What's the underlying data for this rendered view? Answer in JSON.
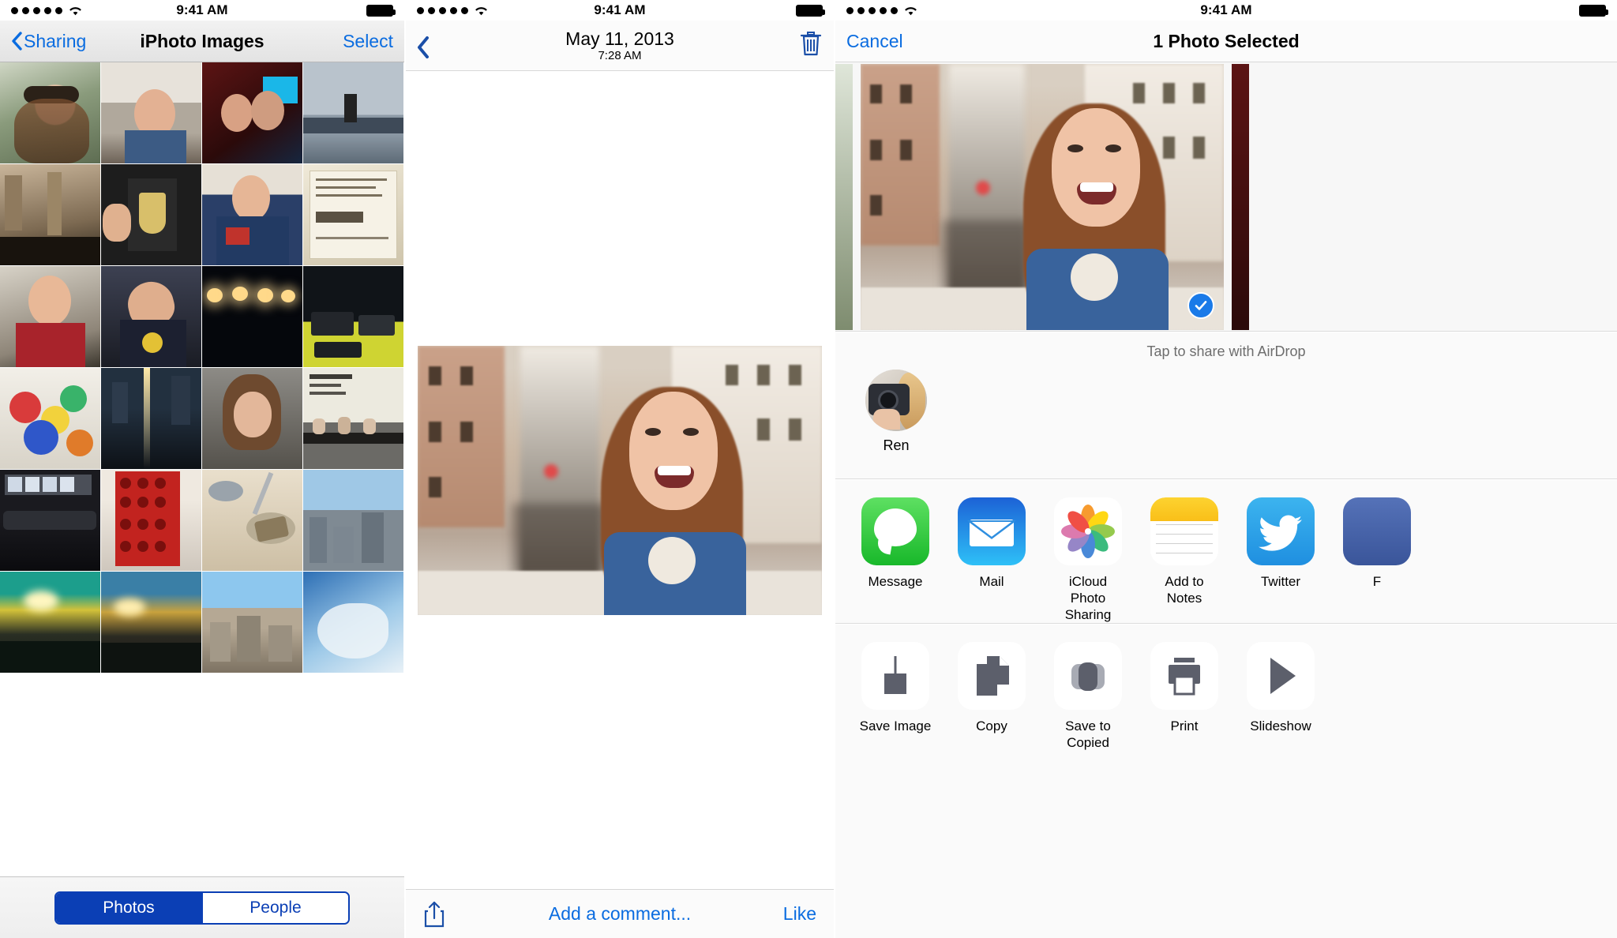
{
  "statusbar": {
    "time": "9:41 AM",
    "signal_dots": 5,
    "wifi_icon": "wifi-icon",
    "battery_icon": "battery-full-icon"
  },
  "panel1": {
    "nav": {
      "back_label": "Sharing",
      "back_icon": "chevron-left-icon",
      "title": "iPhoto Images",
      "right_label": "Select"
    },
    "grid": {
      "columns": 4,
      "rows": 6,
      "cells": [
        {
          "name": "woman-sunglasses-portrait"
        },
        {
          "name": "woman-smiling-piazza"
        },
        {
          "name": "two-women-bar-night"
        },
        {
          "name": "roller-derby-rink"
        },
        {
          "name": "mall-interior-crowd"
        },
        {
          "name": "thumbs-up-anchor-shirt"
        },
        {
          "name": "woman-flag-tank-top"
        },
        {
          "name": "movie-ticket-stub"
        },
        {
          "name": "woman-red-top-smiling"
        },
        {
          "name": "woman-looking-up"
        },
        {
          "name": "stage-lights-night"
        },
        {
          "name": "desk-with-gadgets"
        },
        {
          "name": "balloons-party"
        },
        {
          "name": "city-street-night-lights"
        },
        {
          "name": "woman-wet-hair-selfie"
        },
        {
          "name": "conference-panel-stage"
        },
        {
          "name": "conference-talk-audience"
        },
        {
          "name": "backblaze-red-booth"
        },
        {
          "name": "woodworking-table"
        },
        {
          "name": "city-aerial-dusk"
        },
        {
          "name": "sunset-city-green"
        },
        {
          "name": "sunset-city-orange"
        },
        {
          "name": "city-skyline-day"
        },
        {
          "name": "aerial-snow-coastline"
        }
      ]
    },
    "segmented": {
      "options": [
        "Photos",
        "People"
      ],
      "selected_index": 0
    }
  },
  "panel2": {
    "nav": {
      "back_icon": "chevron-left-icon",
      "title": "May 11, 2013",
      "subtitle": "7:28 AM",
      "trash_icon": "trash-icon"
    },
    "photo": {
      "name": "woman-smiling-spanish-steps"
    },
    "toolbar": {
      "share_icon": "share-up-arrow-icon",
      "comment_label": "Add a comment...",
      "like_label": "Like"
    }
  },
  "panel3": {
    "nav": {
      "cancel_label": "Cancel",
      "title": "1 Photo Selected"
    },
    "filmstrip": {
      "selected": {
        "name": "woman-smiling-spanish-steps",
        "check_icon": "checkmark-circle-icon"
      },
      "left_peek": {
        "name": "previous-photo-peek"
      },
      "right_peek": {
        "name": "next-photo-peek"
      }
    },
    "airdrop": {
      "hint": "Tap to share with AirDrop",
      "contacts": [
        {
          "name": "Ren",
          "avatar": "woman-with-camera-avatar"
        }
      ]
    },
    "apps": [
      {
        "label": "Message",
        "icon": "messages-app-icon"
      },
      {
        "label": "Mail",
        "icon": "mail-app-icon"
      },
      {
        "label": "iCloud Photo Sharing",
        "icon": "photos-app-icon"
      },
      {
        "label": "Add to Notes",
        "icon": "notes-app-icon"
      },
      {
        "label": "Twitter",
        "icon": "twitter-app-icon"
      },
      {
        "label": "F",
        "icon": "facebook-app-icon"
      }
    ],
    "actions": [
      {
        "label": "Save Image",
        "icon": "save-image-icon"
      },
      {
        "label": "Copy",
        "icon": "copy-icon"
      },
      {
        "label": "Save to Copied",
        "icon": "save-to-copied-icon"
      },
      {
        "label": "Print",
        "icon": "printer-icon"
      },
      {
        "label": "Slideshow",
        "icon": "play-triangle-icon"
      }
    ]
  },
  "colors": {
    "tint_blue": "#0a6ce0",
    "segmented_blue": "#0b3fb5",
    "check_blue": "#1a7ae8",
    "gray_glyph": "#5c5f6b"
  }
}
